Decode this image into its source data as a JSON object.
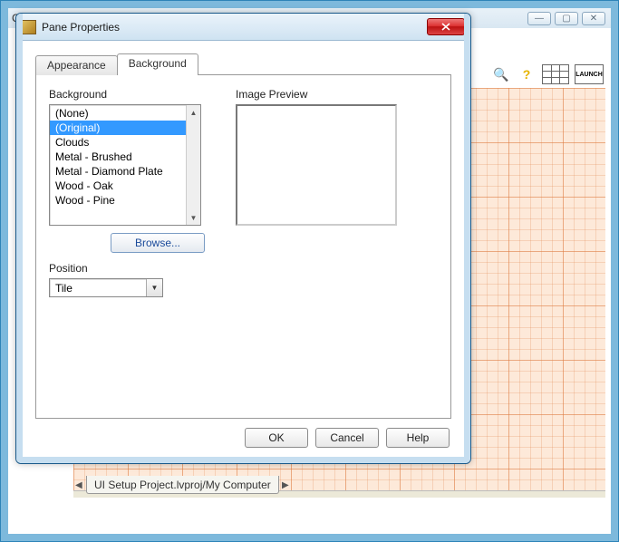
{
  "bgWindow": {
    "titleFragment": "Com...",
    "minimize": "—",
    "maximize": "▢",
    "close": "✕",
    "launch": "LAUNCH",
    "search": "🔍",
    "help": "?",
    "path": "UI Setup Project.lvproj/My Computer"
  },
  "dialog": {
    "title": "Pane Properties",
    "tabs": {
      "appearance": "Appearance",
      "background": "Background"
    },
    "backgroundLabel": "Background",
    "listItems": [
      "(None)",
      "(Original)",
      "Clouds",
      "Metal - Brushed",
      "Metal - Diamond Plate",
      "Wood - Oak",
      "Wood - Pine"
    ],
    "selectedIndex": 1,
    "browse": "Browse...",
    "imagePreviewLabel": "Image Preview",
    "positionLabel": "Position",
    "positionValue": "Tile",
    "ok": "OK",
    "cancel": "Cancel",
    "help": "Help"
  }
}
